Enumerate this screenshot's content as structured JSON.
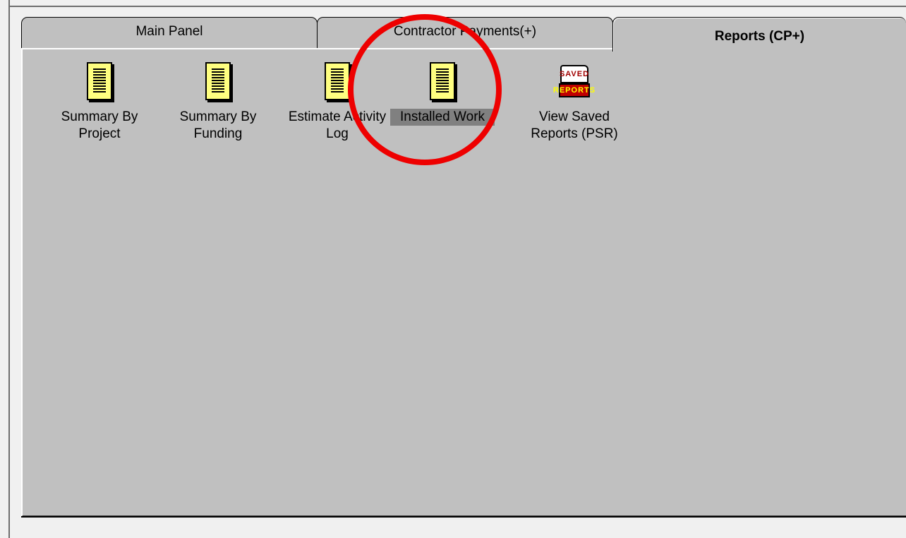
{
  "tabs": {
    "main_panel": "Main Panel",
    "contractor_payments": "Contractor Payments(+)",
    "reports": "Reports (CP+)"
  },
  "reports": [
    {
      "label": "Summary By\nProject",
      "icon": "document-icon"
    },
    {
      "label": "Summary By\nFunding",
      "icon": "document-icon"
    },
    {
      "label": "Estimate Activity\nLog",
      "icon": "document-icon"
    },
    {
      "label": "Installed Work",
      "icon": "document-icon",
      "selected": true
    },
    {
      "label": "View Saved\nReports (PSR)",
      "icon": "saved-reports-icon"
    }
  ],
  "saved_icon": {
    "top_text": "SAVED",
    "bottom_text": "REPORTS"
  },
  "colors": {
    "panel_bg": "#c0c0c0",
    "doc_yellow": "#ffff80",
    "selection": "#808080",
    "annotation_red": "#ee0000"
  },
  "annotation": {
    "shape": "circle",
    "target": "Installed Work"
  }
}
